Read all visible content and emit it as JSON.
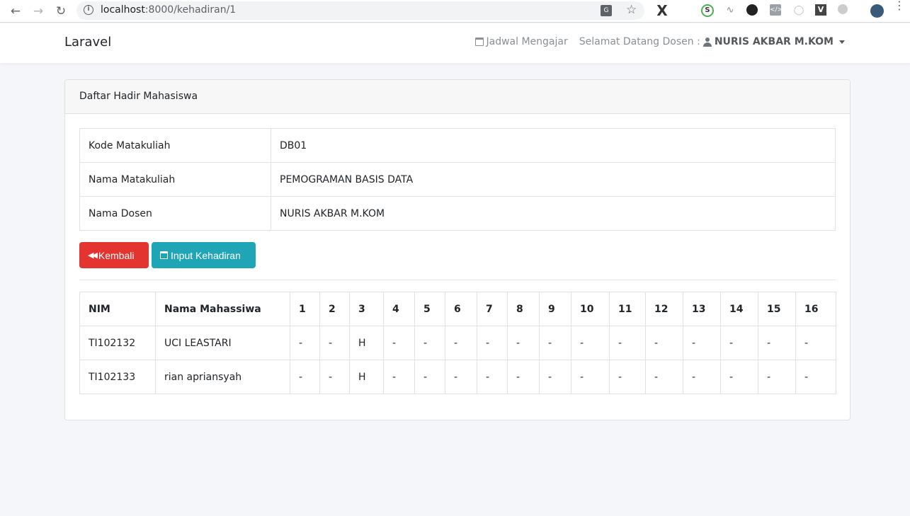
{
  "browser": {
    "url_host": "localhost",
    "url_rest": ":8000/kehadiran/1"
  },
  "navbar": {
    "brand": "Laravel",
    "schedule_link": "Jadwal Mengajar",
    "welcome": "Selamat Datang Dosen :",
    "user": "NURIS AKBAR M.KOM"
  },
  "card": {
    "header": "Daftar Hadir Mahasiswa"
  },
  "course_info": [
    {
      "label": "Kode Matakuliah",
      "value": "DB01"
    },
    {
      "label": "Nama Matakuliah",
      "value": "PEMOGRAMAN BASIS DATA"
    },
    {
      "label": "Nama Dosen",
      "value": "NURIS AKBAR M.KOM"
    }
  ],
  "buttons": {
    "back": "Kembali",
    "input": "Input Kehadiran",
    "back_color": "#e3342f",
    "input_color": "#1fa5b5"
  },
  "attendance": {
    "headers": [
      "NIM",
      "Nama Mahassiwa",
      "1",
      "2",
      "3",
      "4",
      "5",
      "6",
      "7",
      "8",
      "9",
      "10",
      "11",
      "12",
      "13",
      "14",
      "15",
      "16"
    ],
    "rows": [
      [
        "TI102132",
        "UCI LEASTARI",
        "-",
        "-",
        "H",
        "-",
        "-",
        "-",
        "-",
        "-",
        "-",
        "-",
        "-",
        "-",
        "-",
        "-",
        "-",
        "-"
      ],
      [
        "TI102133",
        "rian apriansyah",
        "-",
        "-",
        "H",
        "-",
        "-",
        "-",
        "-",
        "-",
        "-",
        "-",
        "-",
        "-",
        "-",
        "-",
        "-",
        "-"
      ]
    ]
  }
}
